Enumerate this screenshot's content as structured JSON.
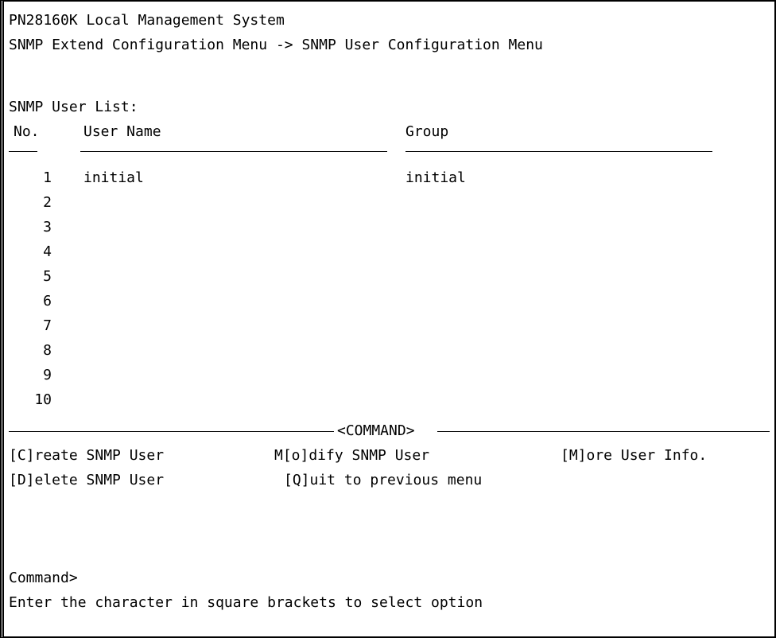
{
  "title": "PN28160K Local Management System",
  "breadcrumb": "SNMP Extend Configuration Menu -> SNMP User Configuration Menu",
  "list_title": "SNMP User List:",
  "columns": {
    "no": "No.",
    "user_name": "User Name",
    "group": "Group"
  },
  "rows": [
    {
      "no": "1",
      "user_name": "initial",
      "group": "initial"
    },
    {
      "no": "2",
      "user_name": "",
      "group": ""
    },
    {
      "no": "3",
      "user_name": "",
      "group": ""
    },
    {
      "no": "4",
      "user_name": "",
      "group": ""
    },
    {
      "no": "5",
      "user_name": "",
      "group": ""
    },
    {
      "no": "6",
      "user_name": "",
      "group": ""
    },
    {
      "no": "7",
      "user_name": "",
      "group": ""
    },
    {
      "no": "8",
      "user_name": "",
      "group": ""
    },
    {
      "no": "9",
      "user_name": "",
      "group": ""
    },
    {
      "no": "10",
      "user_name": "",
      "group": ""
    }
  ],
  "command_label": "<COMMAND>",
  "commands": {
    "create": "[C]reate SNMP User",
    "modify": "M[o]dify SNMP User",
    "more": "[M]ore User Info.",
    "delete": "[D]elete SNMP User",
    "quit": "[Q]uit to previous menu"
  },
  "prompt": "Command>",
  "hint": "Enter the character in square brackets to select option"
}
